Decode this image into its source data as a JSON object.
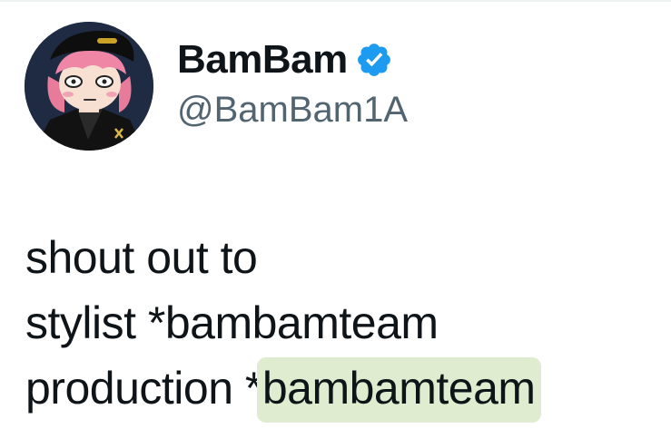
{
  "author": {
    "display_name": "BamBam",
    "handle": "@BamBam1A",
    "verified": true,
    "verified_color": "#1d9bf0",
    "avatar": "cartoon-avatar-pink-hair-black-cap"
  },
  "tweet": {
    "line1": "shout out to",
    "line2": "stylist *bambamteam",
    "line3_prefix": "production *",
    "line3_highlight": "bambamteam",
    "highlight_color": "#dfeccf"
  }
}
